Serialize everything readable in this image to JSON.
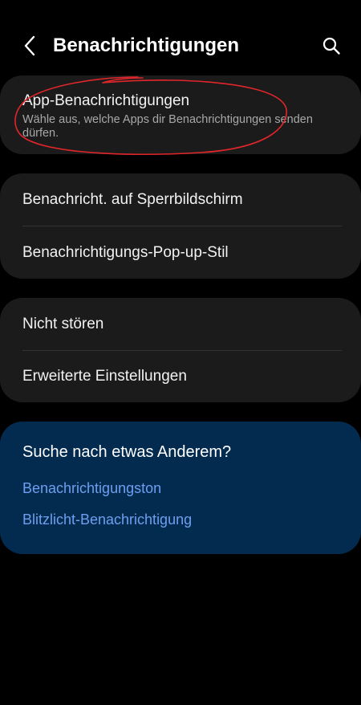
{
  "header": {
    "title": "Benachrichtigungen",
    "back_icon": "chevron-left-icon",
    "search_icon": "search-icon"
  },
  "groups": [
    {
      "items": [
        {
          "title": "App-Benachrichtigungen",
          "subtitle": "Wähle aus, welche Apps dir Benachrichtigungen senden dürfen."
        }
      ]
    },
    {
      "items": [
        {
          "title": "Benachricht. auf Sperrbildschirm"
        },
        {
          "title": "Benachrichtigungs-Pop-up-Stil"
        }
      ]
    },
    {
      "items": [
        {
          "title": "Nicht stören"
        },
        {
          "title": "Erweiterte Einstellungen"
        }
      ]
    }
  ],
  "suggestions": {
    "heading": "Suche nach etwas Anderem?",
    "links": [
      "Benachrichtigungston",
      "Blitzlicht-Benachrichtigung"
    ]
  },
  "colors": {
    "background": "#000000",
    "card": "#1b1b1b",
    "suggestion_card": "#022b4f",
    "link": "#6f9ff0",
    "annotation": "#e0262b"
  }
}
